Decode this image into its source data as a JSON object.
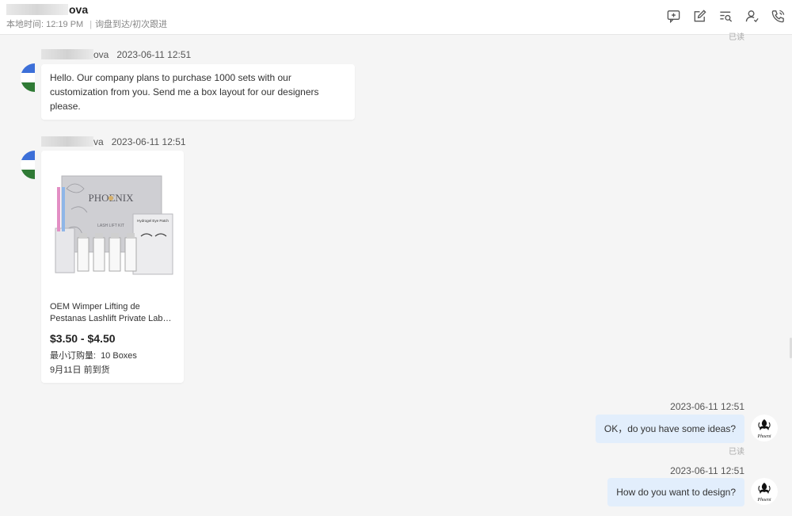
{
  "header": {
    "contact_name_visible": "ova",
    "local_time": "本地时间: 12:19 PM",
    "stage": "询盘到达/初次跟进",
    "tools": [
      "chat-add-icon",
      "edit-icon",
      "search-list-icon",
      "contact-icon",
      "phone-icon"
    ]
  },
  "top_read": "已读",
  "messages_in": [
    {
      "sender_visible": "ova",
      "time": "2023-06-11 12:51",
      "text": "Hello. Our company plans to purchase 1000 sets with our customization from you. Send me a box layout for our designers please."
    },
    {
      "sender_visible": "va",
      "time": "2023-06-11 12:51",
      "product": {
        "title_line1": "OEM Wimper Lifting de",
        "title_line2": "Pestanas Lashlift Private Lab…",
        "price": "$3.50 - $4.50",
        "moq_label": "最小订购量:",
        "moq_value": "10 Boxes",
        "ship": "9月11日 前到货",
        "box_brand": "PHOENIX",
        "box_subtitle": "LASH LIFT KIT",
        "patch_label": "Hydrogel Eye Patch"
      }
    }
  ],
  "messages_out": [
    {
      "time": "2023-06-11 12:51",
      "text": "OK，do you have some ideas?",
      "status": "已读",
      "avatar_text": "Phoeni"
    },
    {
      "time": "2023-06-11 12:51",
      "text": "How do you want to design?",
      "avatar_text": "Phoeni"
    }
  ],
  "colors": {
    "outgoing_bubble": "#e2eefc",
    "incoming_bubble": "#ffffff",
    "background": "#f5f5f5",
    "avatar_blue": "#3c6fd8",
    "avatar_green": "#2f7a35"
  }
}
